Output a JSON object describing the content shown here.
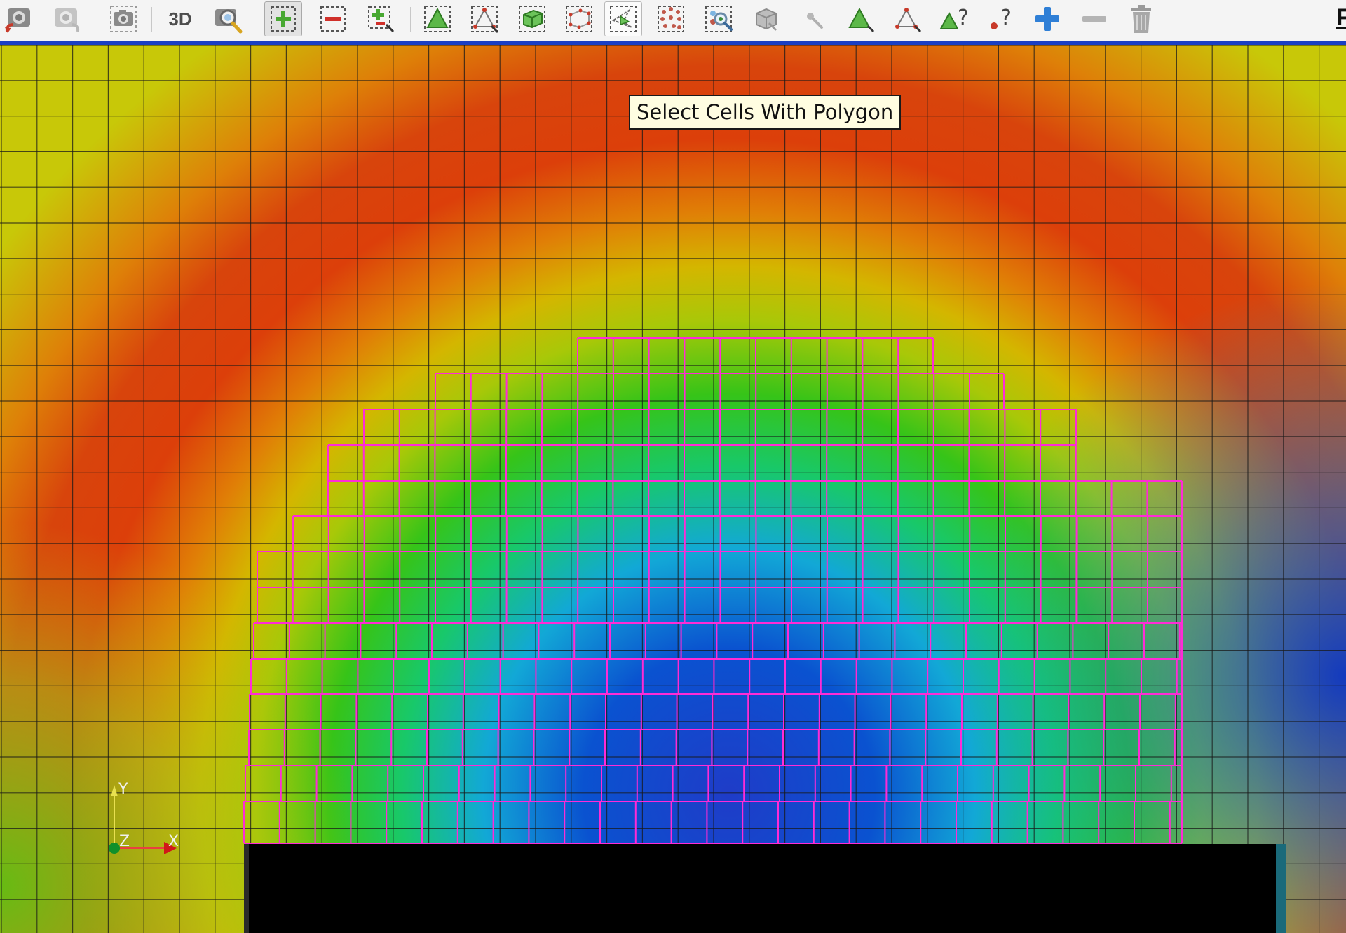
{
  "toolbar": {
    "buttons": [
      {
        "name": "reset-camera-button",
        "icon": "camera-undo-icon",
        "state": "normal"
      },
      {
        "name": "redo-camera-button",
        "icon": "camera-redo-icon",
        "state": "disabled"
      },
      {
        "name": "capture-screenshot-button",
        "icon": "camera-icon",
        "state": "normal"
      },
      {
        "name": "toggle-3d-button",
        "label": "3D",
        "state": "normal"
      },
      {
        "name": "zoom-to-data-button",
        "icon": "magnifier-camera-icon",
        "state": "normal"
      },
      {
        "name": "add-selection-button",
        "icon": "select-add-icon",
        "state": "active"
      },
      {
        "name": "subtract-selection-button",
        "icon": "select-subtract-icon",
        "state": "normal"
      },
      {
        "name": "add-selection-pointer-button",
        "icon": "select-add-pointer-icon",
        "state": "normal"
      },
      {
        "name": "select-cells-on-button",
        "icon": "select-cells-on-icon",
        "state": "normal"
      },
      {
        "name": "select-points-on-button",
        "icon": "select-points-on-icon",
        "state": "normal"
      },
      {
        "name": "select-cells-through-button",
        "icon": "select-cells-through-icon",
        "state": "normal"
      },
      {
        "name": "select-points-through-button",
        "icon": "select-points-through-icon",
        "state": "normal"
      },
      {
        "name": "select-cells-with-polygon-button",
        "icon": "polygon-select-cells-icon",
        "state": "hover"
      },
      {
        "name": "select-points-with-polygon-button",
        "icon": "polygon-select-points-icon",
        "state": "normal"
      },
      {
        "name": "interactive-select-button",
        "icon": "interactive-select-icon",
        "state": "normal"
      },
      {
        "name": "select-block-button",
        "icon": "block-select-icon",
        "state": "disabled"
      },
      {
        "name": "grow-selection-button",
        "icon": "grow-point-icon",
        "state": "disabled"
      },
      {
        "name": "hover-cells-button",
        "icon": "triangle-cell-icon",
        "state": "normal"
      },
      {
        "name": "hover-points-button",
        "icon": "triangle-points-icon",
        "state": "normal"
      },
      {
        "name": "hover-cell-query-button",
        "icon": "cell-query-icon",
        "state": "normal"
      },
      {
        "name": "hover-point-query-button",
        "icon": "point-query-icon",
        "state": "normal"
      },
      {
        "name": "grow-button",
        "icon": "plus-icon",
        "state": "normal"
      },
      {
        "name": "shrink-button",
        "icon": "minus-icon",
        "state": "disabled"
      },
      {
        "name": "clear-selection-button",
        "icon": "trash-icon",
        "state": "disabled"
      }
    ],
    "corner_letter": "F"
  },
  "tooltip": {
    "text": "Select Cells With Polygon"
  },
  "axes": {
    "y": "Y",
    "z": "Z",
    "x": "X"
  },
  "colors": {
    "toolbar_bg": "#f4f4f4",
    "toolbar_border": "#1a3fc4",
    "selection": "#ff2bd6",
    "mesh": "#1a1a1a",
    "obstacle": "#000000"
  }
}
